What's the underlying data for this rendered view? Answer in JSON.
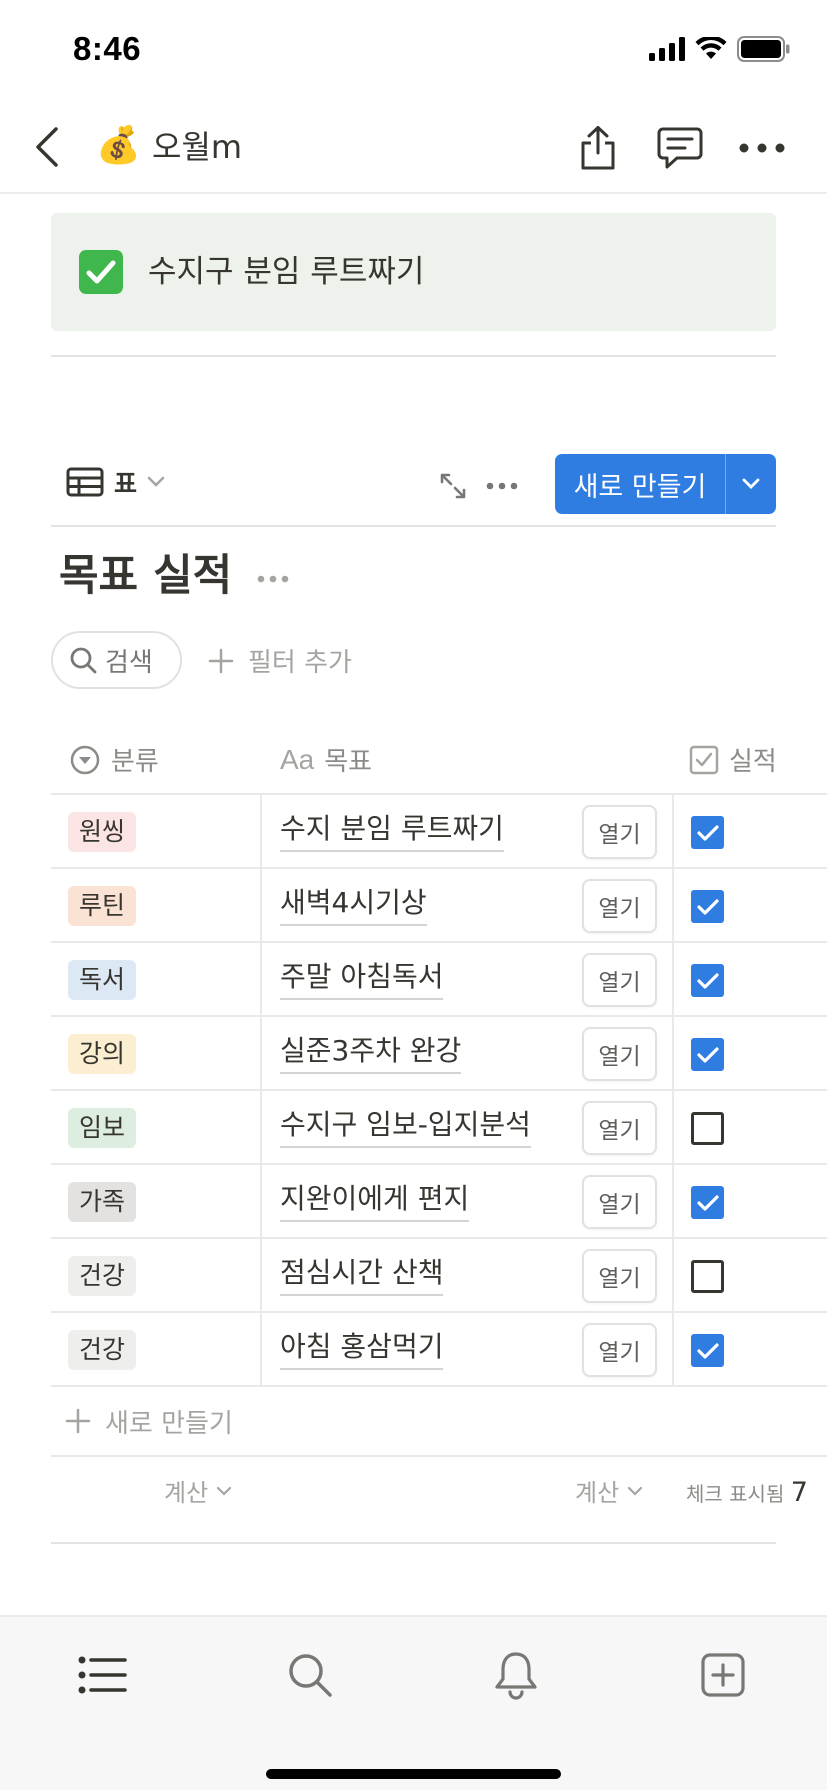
{
  "status_bar": {
    "time": "8:46"
  },
  "nav": {
    "page_emoji": "💰",
    "page_name": "오월m"
  },
  "callout": {
    "text": "수지구 분임 루트짜기"
  },
  "database": {
    "view_label": "표",
    "new_button_label": "새로 만들기",
    "title": "목표 실적",
    "search_label": "검색",
    "filter_add_label": "필터 추가",
    "columns": [
      {
        "label": "분류",
        "icon": "select-icon"
      },
      {
        "label": "목표",
        "icon": "text-aa-icon"
      },
      {
        "label": "실적",
        "icon": "checkbox-icon"
      }
    ],
    "open_label": "열기",
    "rows": [
      {
        "category": "원씽",
        "tag_color": "#fbe4e4",
        "goal": "수지 분임 루트짜기",
        "done": true
      },
      {
        "category": "루틴",
        "tag_color": "#fae3d5",
        "goal": "새벽4시기상",
        "done": true
      },
      {
        "category": "독서",
        "tag_color": "#dce8f3",
        "goal": "주말 아침독서",
        "done": true
      },
      {
        "category": "강의",
        "tag_color": "#fcefd1",
        "goal": "실준3주차 완강",
        "done": true
      },
      {
        "category": "임보",
        "tag_color": "#ddeddf",
        "goal": "수지구 임보-입지분석",
        "done": false
      },
      {
        "category": "가족",
        "tag_color": "#e3e2e0",
        "goal": "지완이에게 편지",
        "done": true
      },
      {
        "category": "건강",
        "tag_color": "#eeeeec",
        "goal": "점심시간 산책",
        "done": false
      },
      {
        "category": "건강",
        "tag_color": "#eeeeec",
        "goal": "아침 홍삼먹기",
        "done": true
      }
    ],
    "add_row_label": "새로 만들기",
    "calc_label_1": "계산",
    "calc_label_2": "계산",
    "check_summary_label": "체크 표시됨",
    "check_summary_value": "7"
  },
  "colors": {
    "accent": "#2f7de1",
    "callout_bg": "#edf3ec"
  }
}
